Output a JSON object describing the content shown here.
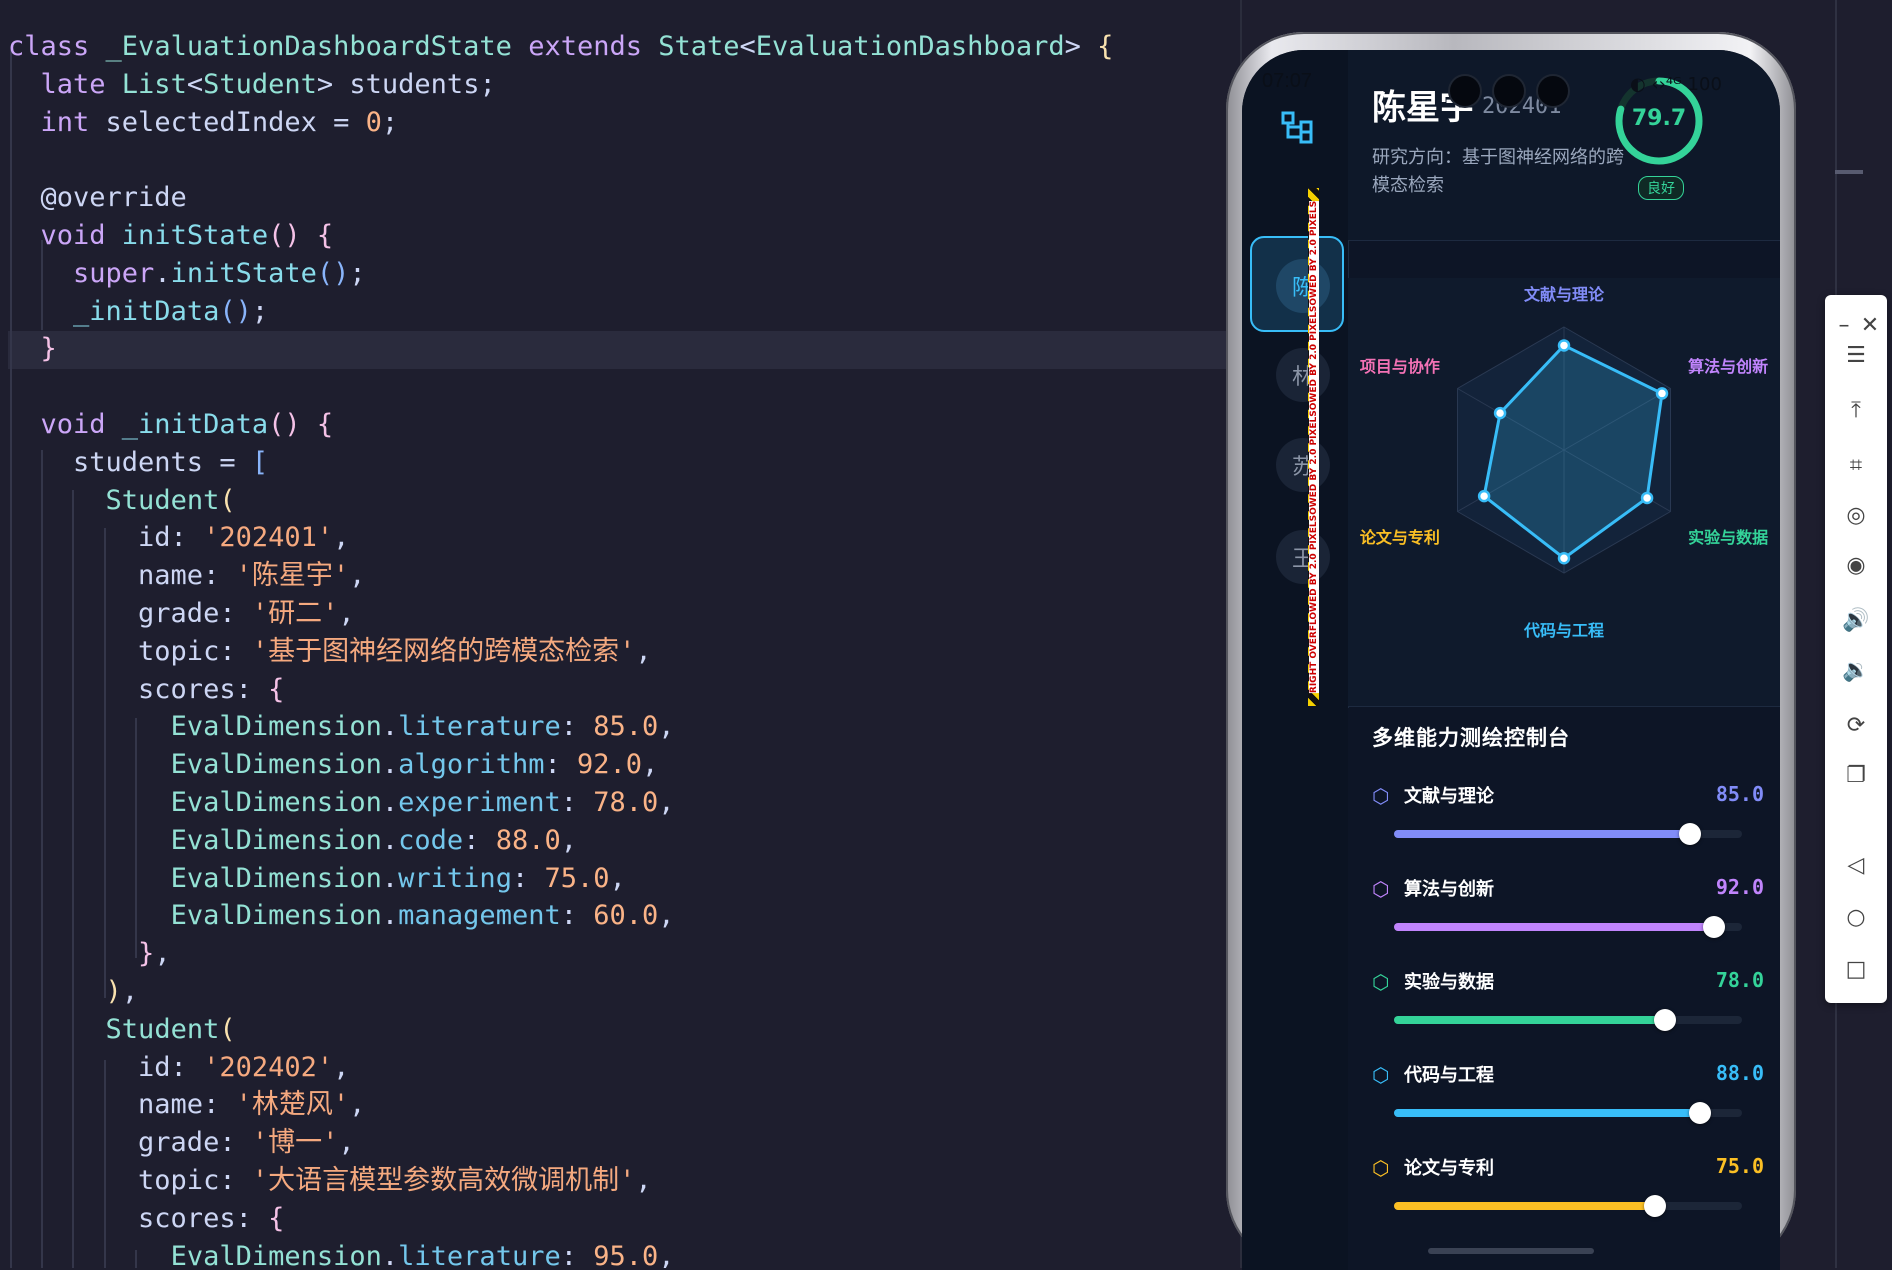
{
  "editor": {
    "lines": [
      [
        [
          "kw",
          "class "
        ],
        [
          "ty",
          "_EvaluationDashboardState "
        ],
        [
          "kw",
          "extends "
        ],
        [
          "ty",
          "State"
        ],
        [
          "tx",
          "<"
        ],
        [
          "ty",
          "EvaluationDashboard"
        ],
        [
          "tx",
          "> "
        ],
        [
          "p1",
          "{"
        ]
      ],
      [
        [
          "tx",
          "  "
        ],
        [
          "kw",
          "late "
        ],
        [
          "ty",
          "List"
        ],
        [
          "tx",
          "<"
        ],
        [
          "ty",
          "Student"
        ],
        [
          "tx",
          "> students;"
        ]
      ],
      [
        [
          "tx",
          "  "
        ],
        [
          "kw",
          "int "
        ],
        [
          "tx",
          "selectedIndex = "
        ],
        [
          "nm",
          "0"
        ],
        [
          "tx",
          ";"
        ]
      ],
      [
        [
          "tx",
          ""
        ]
      ],
      [
        [
          "tx",
          "  "
        ],
        [
          "an",
          "@override"
        ]
      ],
      [
        [
          "tx",
          "  "
        ],
        [
          "kw",
          "void "
        ],
        [
          "fn",
          "initState"
        ],
        [
          "p2",
          "() {"
        ]
      ],
      [
        [
          "tx",
          "    "
        ],
        [
          "kw",
          "super"
        ],
        [
          "tx",
          "."
        ],
        [
          "fn",
          "initState"
        ],
        [
          "p3",
          "()"
        ],
        [
          "tx",
          ";"
        ]
      ],
      [
        [
          "tx",
          "    "
        ],
        [
          "fn",
          "_initData"
        ],
        [
          "p3",
          "()"
        ],
        [
          "tx",
          ";"
        ]
      ],
      [
        [
          "tx",
          "  "
        ],
        [
          "p2",
          "}"
        ]
      ],
      [
        [
          "tx",
          ""
        ]
      ],
      [
        [
          "tx",
          "  "
        ],
        [
          "kw",
          "void "
        ],
        [
          "fn",
          "_initData"
        ],
        [
          "p2",
          "() {"
        ]
      ],
      [
        [
          "tx",
          "    students = "
        ],
        [
          "p3",
          "["
        ]
      ],
      [
        [
          "tx",
          "      "
        ],
        [
          "ty",
          "Student"
        ],
        [
          "p1",
          "("
        ]
      ],
      [
        [
          "tx",
          "        id: "
        ],
        [
          "st",
          "'202401'"
        ],
        [
          "tx",
          ","
        ]
      ],
      [
        [
          "tx",
          "        name: "
        ],
        [
          "st",
          "'陈星宇'"
        ],
        [
          "tx",
          ","
        ]
      ],
      [
        [
          "tx",
          "        grade: "
        ],
        [
          "st",
          "'研二'"
        ],
        [
          "tx",
          ","
        ]
      ],
      [
        [
          "tx",
          "        topic: "
        ],
        [
          "st",
          "'基于图神经网络的跨模态检索'"
        ],
        [
          "tx",
          ","
        ]
      ],
      [
        [
          "tx",
          "        scores: "
        ],
        [
          "p2",
          "{"
        ]
      ],
      [
        [
          "tx",
          "          "
        ],
        [
          "ty",
          "EvalDimension"
        ],
        [
          "tx",
          "."
        ],
        [
          "em",
          "literature"
        ],
        [
          "tx",
          ": "
        ],
        [
          "nm",
          "85.0"
        ],
        [
          "tx",
          ","
        ]
      ],
      [
        [
          "tx",
          "          "
        ],
        [
          "ty",
          "EvalDimension"
        ],
        [
          "tx",
          "."
        ],
        [
          "em",
          "algorithm"
        ],
        [
          "tx",
          ": "
        ],
        [
          "nm",
          "92.0"
        ],
        [
          "tx",
          ","
        ]
      ],
      [
        [
          "tx",
          "          "
        ],
        [
          "ty",
          "EvalDimension"
        ],
        [
          "tx",
          "."
        ],
        [
          "em",
          "experiment"
        ],
        [
          "tx",
          ": "
        ],
        [
          "nm",
          "78.0"
        ],
        [
          "tx",
          ","
        ]
      ],
      [
        [
          "tx",
          "          "
        ],
        [
          "ty",
          "EvalDimension"
        ],
        [
          "tx",
          "."
        ],
        [
          "em",
          "code"
        ],
        [
          "tx",
          ": "
        ],
        [
          "nm",
          "88.0"
        ],
        [
          "tx",
          ","
        ]
      ],
      [
        [
          "tx",
          "          "
        ],
        [
          "ty",
          "EvalDimension"
        ],
        [
          "tx",
          "."
        ],
        [
          "em",
          "writing"
        ],
        [
          "tx",
          ": "
        ],
        [
          "nm",
          "75.0"
        ],
        [
          "tx",
          ","
        ]
      ],
      [
        [
          "tx",
          "          "
        ],
        [
          "ty",
          "EvalDimension"
        ],
        [
          "tx",
          "."
        ],
        [
          "em",
          "management"
        ],
        [
          "tx",
          ": "
        ],
        [
          "nm",
          "60.0"
        ],
        [
          "tx",
          ","
        ]
      ],
      [
        [
          "tx",
          "        "
        ],
        [
          "p2",
          "}"
        ],
        [
          "tx",
          ","
        ]
      ],
      [
        [
          "tx",
          "      "
        ],
        [
          "p1",
          ")"
        ],
        [
          "tx",
          ","
        ]
      ],
      [
        [
          "tx",
          "      "
        ],
        [
          "ty",
          "Student"
        ],
        [
          "p1",
          "("
        ]
      ],
      [
        [
          "tx",
          "        id: "
        ],
        [
          "st",
          "'202402'"
        ],
        [
          "tx",
          ","
        ]
      ],
      [
        [
          "tx",
          "        name: "
        ],
        [
          "st",
          "'林楚风'"
        ],
        [
          "tx",
          ","
        ]
      ],
      [
        [
          "tx",
          "        grade: "
        ],
        [
          "st",
          "'博一'"
        ],
        [
          "tx",
          ","
        ]
      ],
      [
        [
          "tx",
          "        topic: "
        ],
        [
          "st",
          "'大语言模型参数高效微调机制'"
        ],
        [
          "tx",
          ","
        ]
      ],
      [
        [
          "tx",
          "        scores: "
        ],
        [
          "p2",
          "{"
        ]
      ],
      [
        [
          "tx",
          "          "
        ],
        [
          "ty",
          "EvalDimension"
        ],
        [
          "tx",
          "."
        ],
        [
          "em",
          "literature"
        ],
        [
          "tx",
          ": "
        ],
        [
          "nm",
          "95.0"
        ],
        [
          "tx",
          ","
        ]
      ]
    ]
  },
  "phone": {
    "status_time": "07:07",
    "status_icons": "◐ ‹›⁴ᴳ 100",
    "rail_icon": "hierarchy-icon",
    "students": [
      {
        "initial": "陈",
        "selected": true
      },
      {
        "initial": "林",
        "selected": false
      },
      {
        "initial": "苏",
        "selected": false
      },
      {
        "initial": "王",
        "selected": false
      }
    ],
    "overflow_text": "RIGHT OVERFLOWED BY 2.0 PIXELSOWED BY 2.0 PIXELSOWED BY 2.0 PIXELSOWED BY 2.0 PIXELS",
    "header": {
      "name": "陈星宇",
      "id": "202401",
      "topic": "研究方向：基于图神经网络的跨模态检索",
      "total_score": "79.7",
      "total_score_value": 79.7,
      "grade_badge": "良好"
    },
    "radar": {
      "labels": [
        "文献与理论",
        "算法与创新",
        "实验与数据",
        "代码与工程",
        "论文与专利",
        "项目与协作"
      ],
      "label_colors": [
        "#818cf8",
        "#c084fc",
        "#34d399",
        "#38bdf8",
        "#fbbf24",
        "#f472b6"
      ],
      "values": [
        85.0,
        92.0,
        78.0,
        88.0,
        75.0,
        60.0
      ],
      "max": 100,
      "stroke_color": "#38bdf8"
    },
    "control": {
      "title": "多维能力测绘控制台",
      "dimensions": [
        {
          "label": "文献与理论",
          "value_text": "85.0",
          "value": 85.0,
          "color": "#818cf8"
        },
        {
          "label": "算法与创新",
          "value_text": "92.0",
          "value": 92.0,
          "color": "#c084fc"
        },
        {
          "label": "实验与数据",
          "value_text": "78.0",
          "value": 78.0,
          "color": "#34d399"
        },
        {
          "label": "代码与工程",
          "value_text": "88.0",
          "value": 88.0,
          "color": "#38bdf8"
        },
        {
          "label": "论文与专利",
          "value_text": "75.0",
          "value": 75.0,
          "color": "#fbbf24"
        }
      ]
    }
  },
  "toolbar": {
    "items": [
      {
        "name": "minimize-icon",
        "glyph": "–"
      },
      {
        "name": "close-icon",
        "glyph": "✕"
      },
      {
        "name": "menu-icon",
        "glyph": "☰"
      },
      {
        "name": "pin-top-icon",
        "glyph": "⤒"
      },
      {
        "name": "crop-icon",
        "glyph": "⌗"
      },
      {
        "name": "rotate-icon",
        "glyph": "◎"
      },
      {
        "name": "screenshot-icon",
        "glyph": "◉"
      },
      {
        "name": "volume-up-icon",
        "glyph": "🔊"
      },
      {
        "name": "volume-down-icon",
        "glyph": "🔉"
      },
      {
        "name": "shake-icon",
        "glyph": "⟳"
      },
      {
        "name": "multi-window-icon",
        "glyph": "❐"
      },
      {
        "name": "back-icon",
        "glyph": "◁"
      },
      {
        "name": "home-icon",
        "glyph": "○"
      },
      {
        "name": "recents-icon",
        "glyph": "□"
      }
    ]
  }
}
